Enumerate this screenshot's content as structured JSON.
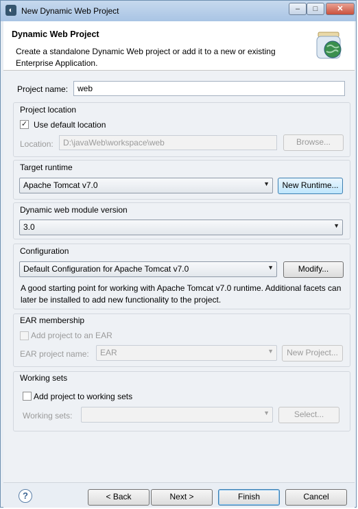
{
  "window": {
    "title": "New Dynamic Web Project",
    "controls": {
      "minimize": "–",
      "maximize": "□",
      "close": "✕"
    }
  },
  "header": {
    "title": "Dynamic Web Project",
    "description": "Create a standalone Dynamic Web project or add it to a new or existing Enterprise Application."
  },
  "project_name": {
    "label": "Project name:",
    "value": "web"
  },
  "project_location": {
    "group_label": "Project location",
    "use_default_label": "Use default location",
    "use_default_checked": true,
    "location_label": "Location:",
    "location_value": "D:\\javaWeb\\workspace\\web",
    "browse_label": "Browse..."
  },
  "target_runtime": {
    "group_label": "Target runtime",
    "selected": "Apache Tomcat v7.0",
    "new_runtime_label": "New Runtime..."
  },
  "module_version": {
    "group_label": "Dynamic web module version",
    "selected": "3.0"
  },
  "configuration": {
    "group_label": "Configuration",
    "selected": "Default Configuration for Apache Tomcat v7.0",
    "modify_label": "Modify...",
    "description": "A good starting point for working with Apache Tomcat v7.0 runtime. Additional facets can later be installed to add new functionality to the project."
  },
  "ear_membership": {
    "group_label": "EAR membership",
    "add_label": "Add project to an EAR",
    "add_checked": false,
    "name_label": "EAR project name:",
    "name_value": "EAR",
    "new_project_label": "New Project..."
  },
  "working_sets": {
    "group_label": "Working sets",
    "add_label": "Add project to working sets",
    "add_checked": false,
    "sets_label": "Working sets:",
    "sets_value": "",
    "select_label": "Select..."
  },
  "footer": {
    "help": "?",
    "back_label": "< Back",
    "next_label": "Next >",
    "finish_label": "Finish",
    "cancel_label": "Cancel"
  }
}
